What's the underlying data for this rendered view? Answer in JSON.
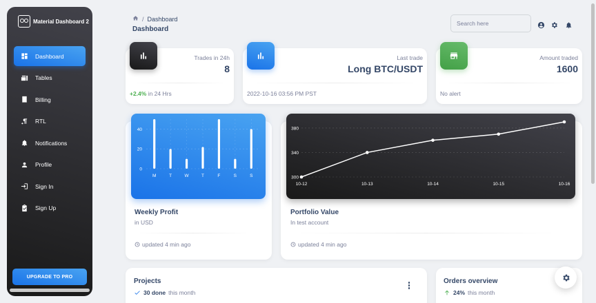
{
  "sidebar": {
    "brand": "Material Dashboard 2",
    "items": [
      {
        "label": "Dashboard",
        "icon": "dashboard-icon",
        "active": true
      },
      {
        "label": "Tables",
        "icon": "table-icon"
      },
      {
        "label": "Billing",
        "icon": "receipt-icon"
      },
      {
        "label": "RTL",
        "icon": "rtl-icon"
      },
      {
        "label": "Notifications",
        "icon": "bell-icon"
      },
      {
        "label": "Profile",
        "icon": "person-icon"
      },
      {
        "label": "Sign In",
        "icon": "login-icon"
      },
      {
        "label": "Sign Up",
        "icon": "clipboard-icon"
      }
    ],
    "upgrade_label": "UPGRADE TO PRO"
  },
  "header": {
    "breadcrumb_current": "Dashboard",
    "title": "Dashboard",
    "search_placeholder": "Search here"
  },
  "stats": [
    {
      "label": "Trades in 24h",
      "value": "8",
      "foot_pct": "+2.4%",
      "foot_text": " in 24 Hrs",
      "icon": "bar-chart-icon",
      "color": "#191919"
    },
    {
      "label": "Last trade",
      "value": "Long BTC/USDT",
      "foot_text": "2022-10-16 03:56 PM PST",
      "icon": "bar-chart-icon",
      "color": "#1A73E8"
    },
    {
      "label": "Amount traded",
      "value": "1600",
      "foot_text": "No alert",
      "icon": "store-icon",
      "color": "#4CAF50"
    }
  ],
  "weekly": {
    "title": "Weekly Profit",
    "subtitle": "in USD",
    "footer": "updated 4 min ago"
  },
  "portfolio": {
    "title": "Portfolio Value",
    "subtitle": "In test account",
    "footer": "updated 4 min ago"
  },
  "projects": {
    "title": "Projects",
    "done": "30 done",
    "rest": "this month"
  },
  "orders": {
    "title": "Orders overview",
    "pct": "24%",
    "rest": "this month"
  },
  "chart_data": [
    {
      "type": "bar",
      "categories": [
        "M",
        "T",
        "W",
        "T",
        "F",
        "S",
        "S"
      ],
      "values": [
        50,
        20,
        10,
        22,
        50,
        10,
        40
      ],
      "yticks": [
        0,
        20,
        40
      ],
      "ylim": [
        0,
        50
      ],
      "color": "#ffffff"
    },
    {
      "type": "line",
      "x": [
        "10-12",
        "10-13",
        "10-14",
        "10-15",
        "10-16"
      ],
      "values": [
        300,
        340,
        360,
        370,
        390
      ],
      "yticks": [
        300,
        340,
        380
      ],
      "ylim": [
        300,
        390
      ],
      "color": "#ffffff"
    }
  ]
}
